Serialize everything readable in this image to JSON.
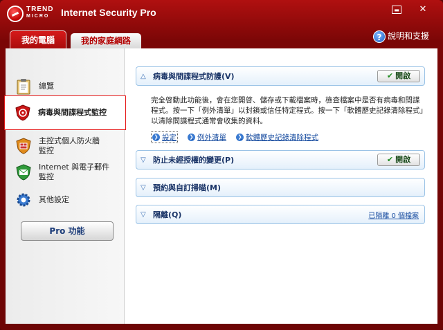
{
  "window": {
    "brand_line1": "TREND",
    "brand_line2": "MICRO",
    "title": "Internet Security Pro"
  },
  "tabs": [
    {
      "label": "我的電腦",
      "active": true
    },
    {
      "label": "我的家庭網路",
      "active": false
    }
  ],
  "help_label": "說明和支援",
  "sidebar": {
    "items": [
      {
        "label": "總覽"
      },
      {
        "label": "病毒與間諜程式監控",
        "selected": true
      },
      {
        "label": "主控式個人防火牆\n監控"
      },
      {
        "label": "Internet 與電子郵件\n監控"
      },
      {
        "label": "其他設定"
      }
    ],
    "pro_button": "Pro 功能"
  },
  "panels": {
    "virus": {
      "title": "病毒與間諜程式防護(V)",
      "status": "開啟",
      "description": "完全啓動此功能後，會在您開啓、儲存或下載檔案時，檢查檔案中是否有病毒和間諜程式。按一下「例外清單」以封鎖或信任特定程式。按一下「軟體歷史記錄清除程式」以清除間諜程式通常會收集的資料。",
      "links": [
        "設定",
        "例外清單",
        "軟體歷史記錄清除程式"
      ]
    },
    "unauthorized": {
      "title": "防止未經授權的變更(P)",
      "status": "開啟"
    },
    "scan": {
      "title": "預約與自訂掃瞄(M)"
    },
    "quarantine": {
      "title": "隔離(Q)",
      "info": "已隔離 0 個檔案"
    }
  },
  "colors": {
    "frame": "#8a0808",
    "accent_red": "#e51717",
    "panel_border": "#9bc3e6",
    "link_blue": "#1a4ea1"
  }
}
